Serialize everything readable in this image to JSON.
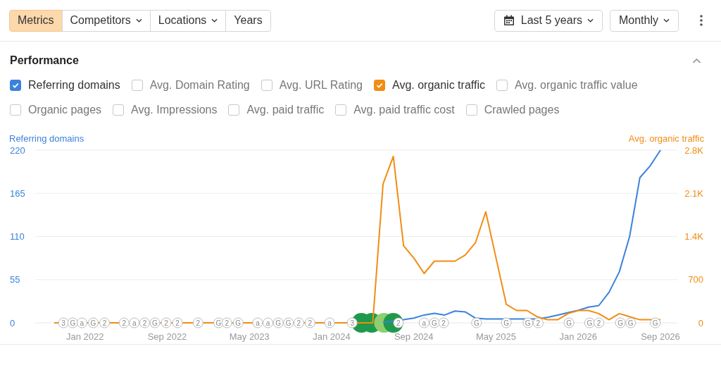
{
  "toolbar": {
    "segments": [
      {
        "label": "Metrics",
        "selected": true,
        "dropdown": false
      },
      {
        "label": "Competitors",
        "selected": false,
        "dropdown": true
      },
      {
        "label": "Locations",
        "selected": false,
        "dropdown": true
      },
      {
        "label": "Years",
        "selected": false,
        "dropdown": false
      }
    ],
    "date_range": "Last 5 years",
    "interval": "Monthly"
  },
  "performance": {
    "title": "Performance",
    "expanded": true,
    "metrics": [
      [
        {
          "label": "Referring domains",
          "checked": true,
          "color": "#3b82db"
        },
        {
          "label": "Avg. Domain Rating",
          "checked": false
        },
        {
          "label": "Avg. URL Rating",
          "checked": false
        },
        {
          "label": "Avg. organic traffic",
          "checked": true,
          "color": "#f28c12"
        },
        {
          "label": "Avg. organic traffic value",
          "checked": false
        }
      ],
      [
        {
          "label": "Organic pages",
          "checked": false
        },
        {
          "label": "Avg. Impressions",
          "checked": false
        },
        {
          "label": "Avg. paid traffic",
          "checked": false
        },
        {
          "label": "Avg. paid traffic cost",
          "checked": false
        },
        {
          "label": "Crawled pages",
          "checked": false
        }
      ]
    ],
    "chart_data": {
      "type": "line",
      "grid": true,
      "categories": [
        null,
        null,
        null,
        "Jan 2022",
        null,
        null,
        null,
        null,
        null,
        null,
        null,
        "Sep 2022",
        null,
        null,
        null,
        null,
        null,
        null,
        null,
        "May 2023",
        null,
        null,
        null,
        null,
        null,
        null,
        null,
        "Jan 2024",
        null,
        null,
        null,
        null,
        null,
        null,
        null,
        "Sep 2024",
        null,
        null,
        null,
        null,
        null,
        null,
        null,
        "May 2025",
        null,
        null,
        null,
        null,
        null,
        null,
        null,
        "Jan 2026",
        null,
        null,
        null,
        null,
        null,
        null,
        null,
        "Sep 2026"
      ],
      "ylim": [
        0,
        220
      ],
      "y2lim": [
        0,
        2800
      ],
      "yticks": [
        0,
        55,
        110,
        165,
        220
      ],
      "y2ticks": [
        {
          "value": 0,
          "label": "0"
        },
        {
          "value": 700,
          "label": "700"
        },
        {
          "value": 1400,
          "label": "1.4K"
        },
        {
          "value": 2100,
          "label": "2.1K"
        },
        {
          "value": 2800,
          "label": "2.8K"
        }
      ],
      "series": [
        {
          "name": "Referring domains",
          "color": "#3b82db",
          "values": [
            null,
            null,
            null,
            null,
            null,
            null,
            null,
            null,
            null,
            null,
            null,
            null,
            null,
            null,
            null,
            null,
            null,
            null,
            null,
            null,
            null,
            null,
            null,
            null,
            null,
            null,
            null,
            null,
            null,
            null,
            null,
            null,
            1,
            2,
            4,
            6,
            10,
            12,
            10,
            15,
            14,
            6,
            5,
            5,
            5,
            5,
            5,
            5,
            7,
            10,
            13,
            16,
            20,
            22,
            39,
            65,
            110,
            185,
            200,
            220
          ]
        },
        {
          "name": "Avg. organic traffic",
          "color": "#f28c12",
          "axis": "y2",
          "values": [
            0,
            0,
            0,
            0,
            0,
            0,
            0,
            0,
            0,
            0,
            0,
            0,
            0,
            0,
            0,
            0,
            0,
            0,
            0,
            0,
            0,
            0,
            0,
            0,
            0,
            0,
            0,
            0,
            0,
            0,
            0,
            0,
            2250,
            2700,
            1250,
            1050,
            800,
            1000,
            1000,
            1000,
            1100,
            1300,
            1800,
            1050,
            300,
            200,
            200,
            100,
            50,
            50,
            150,
            200,
            200,
            150,
            50,
            150,
            100,
            50,
            50,
            50
          ]
        }
      ]
    },
    "markers": [
      "3",
      "G",
      "a",
      "G",
      "2",
      "2",
      "a",
      "2",
      "G",
      "2",
      "2",
      "2",
      "G",
      "2",
      "G",
      "a",
      "a",
      "G",
      "G",
      "2",
      "2",
      "a",
      "3",
      "2",
      "a",
      "G",
      "2",
      "G",
      "G",
      "G",
      "2",
      "G",
      "G",
      "2",
      "G",
      "G",
      "G"
    ]
  }
}
